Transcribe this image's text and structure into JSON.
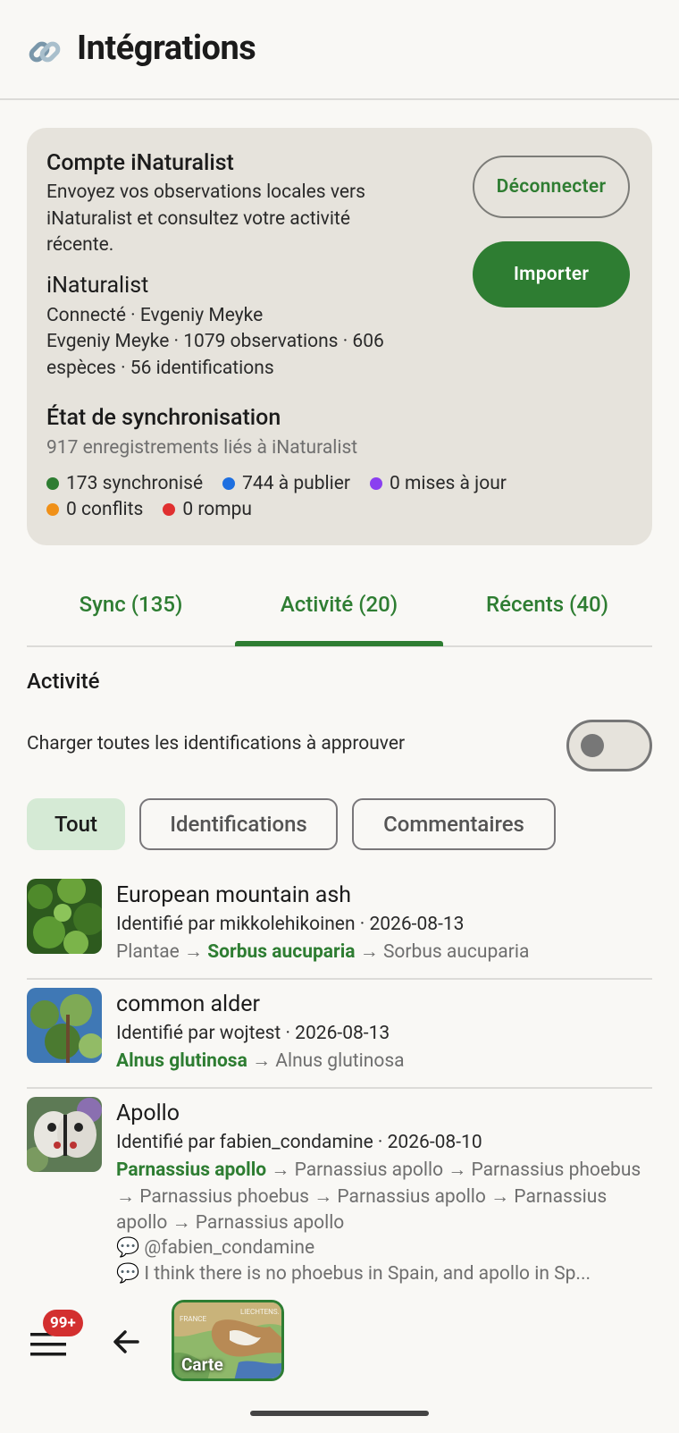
{
  "header": {
    "title": "Intégrations",
    "icon": "link-icon"
  },
  "account": {
    "title": "Compte iNaturalist",
    "description": "Envoyez vos observations locales vers iNaturalist et consultez votre activité récente.",
    "service_name": "iNaturalist",
    "connected_line": "Connecté · Evgeniy Meyke",
    "stats_line": "Evgeniy Meyke · 1079 observations · 606 espèces · 56 identifications",
    "disconnect_label": "Déconnecter",
    "import_label": "Importer"
  },
  "sync_state": {
    "title": "État de synchronisation",
    "subtitle": "917 enregistrements liés à iNaturalist",
    "legend": [
      {
        "label": "173 synchronisé",
        "color": "#2e7d32"
      },
      {
        "label": "744 à publier",
        "color": "#1e6fe0"
      },
      {
        "label": "0 mises à jour",
        "color": "#8a3ff0"
      },
      {
        "label": "0 conflits",
        "color": "#f09018"
      },
      {
        "label": "0 rompu",
        "color": "#e03030"
      }
    ]
  },
  "tabs": [
    {
      "label": "Sync (135)",
      "selected": false
    },
    {
      "label": "Activité (20)",
      "selected": true
    },
    {
      "label": "Récents (40)",
      "selected": false
    }
  ],
  "activity": {
    "title": "Activité",
    "toggle_label": "Charger toutes les identifications à approuver",
    "toggle_on": false,
    "filters": [
      {
        "label": "Tout",
        "selected": true
      },
      {
        "label": "Identifications",
        "selected": false
      },
      {
        "label": "Commentaires",
        "selected": false
      }
    ],
    "items": [
      {
        "name": "European mountain ash",
        "meta": "Identifié par mikkolehikoinen · 2026-08-13",
        "chain_prefix": "Plantae →",
        "chain_highlight": "Sorbus aucuparia",
        "chain_rest": "→ Sorbus aucuparia"
      },
      {
        "name": "common alder",
        "meta": "Identifié par wojtest · 2026-08-13",
        "chain_highlight": "Alnus glutinosa",
        "chain_rest": "→ Alnus glutinosa"
      },
      {
        "name": "Apollo",
        "meta": "Identifié par fabien_condamine · 2026-08-10",
        "chain_highlight": "Parnassius apollo",
        "chain_rest": "→ Parnassius apollo → Parnassius phoebus → Parnassius phoebus → Parnassius apollo → Parnassius apollo → Parnassius apollo",
        "comment_1": "💬 @fabien_condamine",
        "comment_2": "💬 I think there is no phoebus in Spain, and apollo in Sp..."
      }
    ]
  },
  "bottom_bar": {
    "badge": "99+",
    "map_label": "Carte",
    "map_text_1": "FRANCE",
    "map_text_2": "LIECHTENS."
  }
}
